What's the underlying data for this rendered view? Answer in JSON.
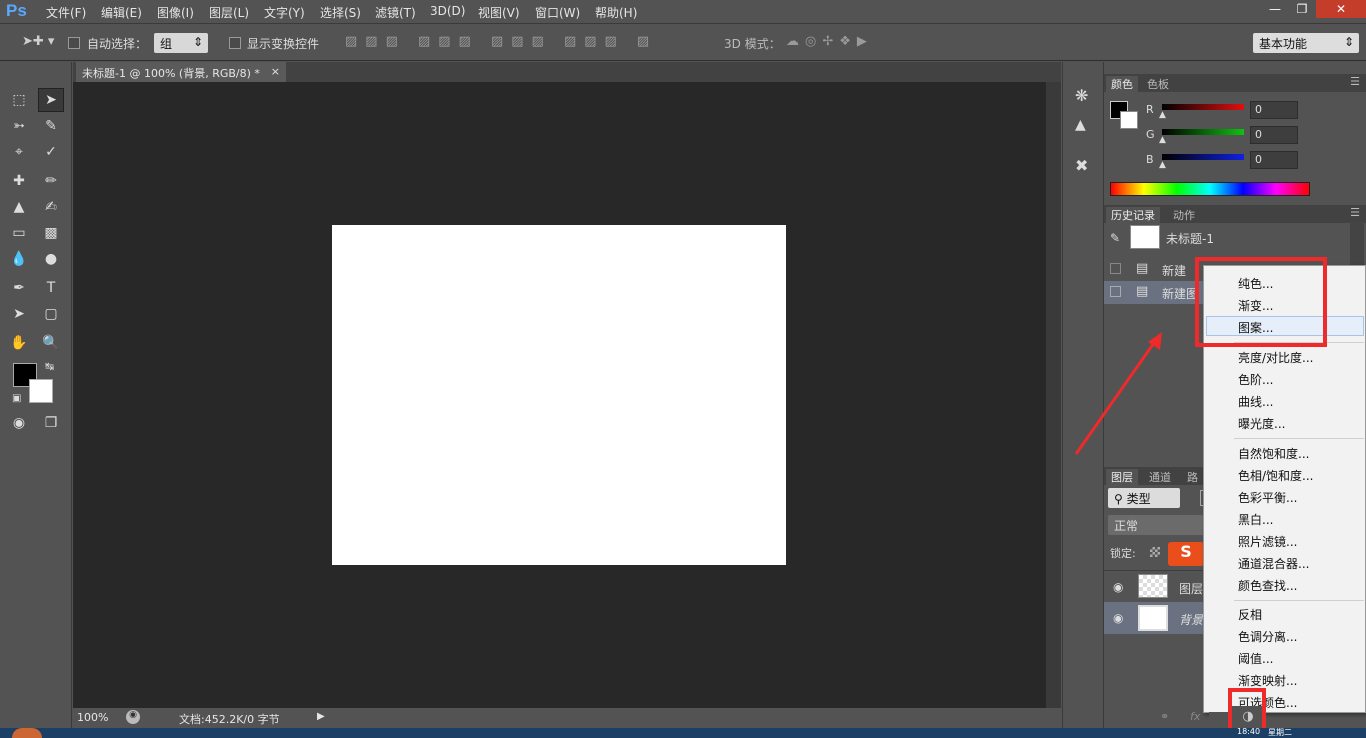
{
  "app": {
    "logo": "Ps"
  },
  "menu": [
    "文件(F)",
    "编辑(E)",
    "图像(I)",
    "图层(L)",
    "文字(Y)",
    "选择(S)",
    "滤镜(T)",
    "3D(D)",
    "视图(V)",
    "窗口(W)",
    "帮助(H)"
  ],
  "options": {
    "auto_select": "自动选择：",
    "group": "组",
    "show_transform": "显示变换控件",
    "mode3d": "3D 模式：",
    "workspace": "基本功能"
  },
  "document": {
    "tab_title": "未标题-1 @ 100% (背景, RGB/8) *",
    "zoom": "100%",
    "doc_info": "文档:452.2K/0 字节"
  },
  "color_panel": {
    "tabs": [
      "颜色",
      "色板"
    ],
    "r_label": "R",
    "g_label": "G",
    "b_label": "B",
    "r": "0",
    "g": "0",
    "b": "0",
    "r_color": "#e01010",
    "g_color": "#10c010",
    "b_color": "#1020e0"
  },
  "history_panel": {
    "tabs": [
      "历史记录",
      "动作"
    ],
    "snapshot": "未标题-1",
    "items": [
      "新建",
      "新建图"
    ]
  },
  "layers_panel": {
    "tabs": [
      "图层",
      "通道",
      "路"
    ],
    "kind": "类型",
    "blend": "正常",
    "lock": "锁定:",
    "layers": [
      "图层",
      "背景"
    ]
  },
  "context_menu": {
    "group1": [
      "纯色...",
      "渐变...",
      "图案..."
    ],
    "group2": [
      "亮度/对比度...",
      "色阶...",
      "曲线...",
      "曝光度..."
    ],
    "group3": [
      "自然饱和度...",
      "色相/饱和度...",
      "色彩平衡...",
      "黑白...",
      "照片滤镜...",
      "通道混合器...",
      "颜色查找..."
    ],
    "group4": [
      "反相",
      "色调分离...",
      "阈值...",
      "渐变映射...",
      "可选颜色..."
    ]
  },
  "taskbar": {
    "time": "18:40",
    "day": "星期二"
  },
  "colors": {
    "accent": "#ee2a2a",
    "bg": "#535353",
    "canvas_bg": "#282828"
  }
}
